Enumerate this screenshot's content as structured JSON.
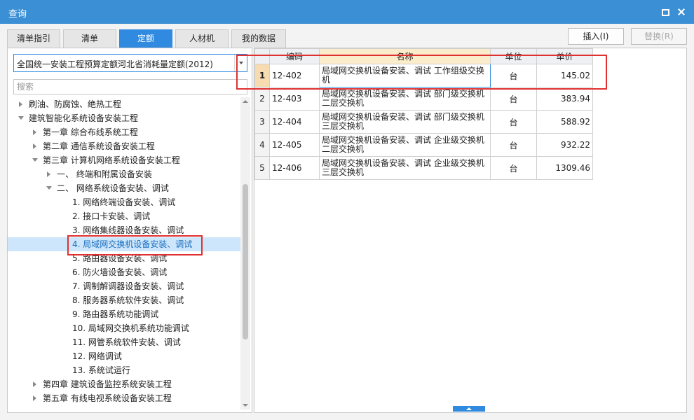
{
  "window": {
    "title": "查询"
  },
  "tabs": [
    {
      "label": "清单指引"
    },
    {
      "label": "清单"
    },
    {
      "label": "定额"
    },
    {
      "label": "人材机"
    },
    {
      "label": "我的数据"
    }
  ],
  "actions": {
    "insert_label": "插入(I)",
    "replace_label": "替换(R)"
  },
  "library": {
    "selected": "全国统一安装工程预算定额河北省消耗量定额(2012)"
  },
  "search": {
    "placeholder": "搜索"
  },
  "tree": [
    {
      "label": "刷油、防腐蚀、绝热工程",
      "expander": "collapsed"
    },
    {
      "label": "建筑智能化系统设备安装工程",
      "expander": "expanded"
    },
    {
      "label": "第一章 综合布线系统工程",
      "expander": "collapsed"
    },
    {
      "label": "第二章 通信系统设备安装工程",
      "expander": "collapsed"
    },
    {
      "label": "第三章 计算机网络系统设备安装工程",
      "expander": "expanded"
    },
    {
      "label": "一、 终端和附属设备安装",
      "expander": "collapsed"
    },
    {
      "label": "二、 网络系统设备安装、调试",
      "expander": "expanded"
    },
    {
      "label": "1. 网络终端设备安装、调试",
      "expander": ""
    },
    {
      "label": "2. 接口卡安装、调试",
      "expander": ""
    },
    {
      "label": "3. 网络集线器设备安装、调试",
      "expander": ""
    },
    {
      "label": "4. 局域网交换机设备安装、调试",
      "expander": ""
    },
    {
      "label": "5. 路由器设备安装、调试",
      "expander": ""
    },
    {
      "label": "6. 防火墙设备安装、调试",
      "expander": ""
    },
    {
      "label": "7. 调制解调器设备安装、调试",
      "expander": ""
    },
    {
      "label": "8. 服务器系统软件安装、调试",
      "expander": ""
    },
    {
      "label": "9. 路由器系统功能调试",
      "expander": ""
    },
    {
      "label": "10. 局域网交换机系统功能调试",
      "expander": ""
    },
    {
      "label": "11. 网管系统软件安装、调试",
      "expander": ""
    },
    {
      "label": "12. 网络调试",
      "expander": ""
    },
    {
      "label": "13. 系统试运行",
      "expander": ""
    },
    {
      "label": "第四章 建筑设备监控系统安装工程",
      "expander": "collapsed"
    },
    {
      "label": "第五章 有线电视系统设备安装工程",
      "expander": "collapsed"
    }
  ],
  "grid": {
    "columns": {
      "code": "编码",
      "name": "名称",
      "unit": "单位",
      "price": "单价"
    },
    "rows": [
      {
        "num": "1",
        "code": "12-402",
        "name": "局域网交换机设备安装、调试 工作组级交换机",
        "unit": "台",
        "price": "145.02"
      },
      {
        "num": "2",
        "code": "12-403",
        "name": "局域网交换机设备安装、调试 部门级交换机 二层交换机",
        "unit": "台",
        "price": "383.94"
      },
      {
        "num": "3",
        "code": "12-404",
        "name": "局域网交换机设备安装、调试 部门级交换机 三层交换机",
        "unit": "台",
        "price": "588.92"
      },
      {
        "num": "4",
        "code": "12-405",
        "name": "局域网交换机设备安装、调试 企业级交换机 二层交换机",
        "unit": "台",
        "price": "932.22"
      },
      {
        "num": "5",
        "code": "12-406",
        "name": "局域网交换机设备安装、调试 企业级交换机 三层交换机",
        "unit": "台",
        "price": "1309.46"
      }
    ]
  },
  "colors": {
    "titlebar": "#3b8fd4",
    "accent": "#2f8ae0",
    "highlight": "#e03131",
    "selection": "#cde6fb"
  }
}
